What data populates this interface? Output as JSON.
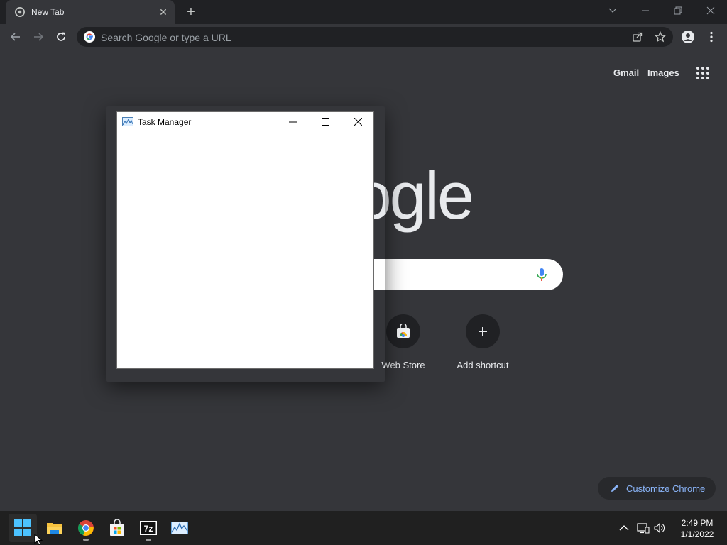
{
  "browser": {
    "tab_title": "New Tab",
    "omnibox_placeholder": "Search Google or type a URL"
  },
  "ntp": {
    "gmail": "Gmail",
    "images": "Images",
    "logo_text": "Google",
    "shortcuts": [
      {
        "label": "Web Store",
        "icon": "web-store-icon"
      },
      {
        "label": "Add shortcut",
        "icon": "plus-icon"
      }
    ],
    "customize_label": "Customize Chrome"
  },
  "task_manager": {
    "title": "Task Manager"
  },
  "taskbar": {
    "apps": [
      "windows-start-icon",
      "file-explorer-icon",
      "chrome-icon",
      "microsoft-store-icon",
      "7zip-icon",
      "task-manager-icon"
    ],
    "time": "2:49 PM",
    "date": "1/1/2022"
  },
  "colors": {
    "ntp_background": "#35363a",
    "tabstrip": "#202124",
    "accent_link": "#8ab4f8",
    "taskbar": "#202020"
  }
}
